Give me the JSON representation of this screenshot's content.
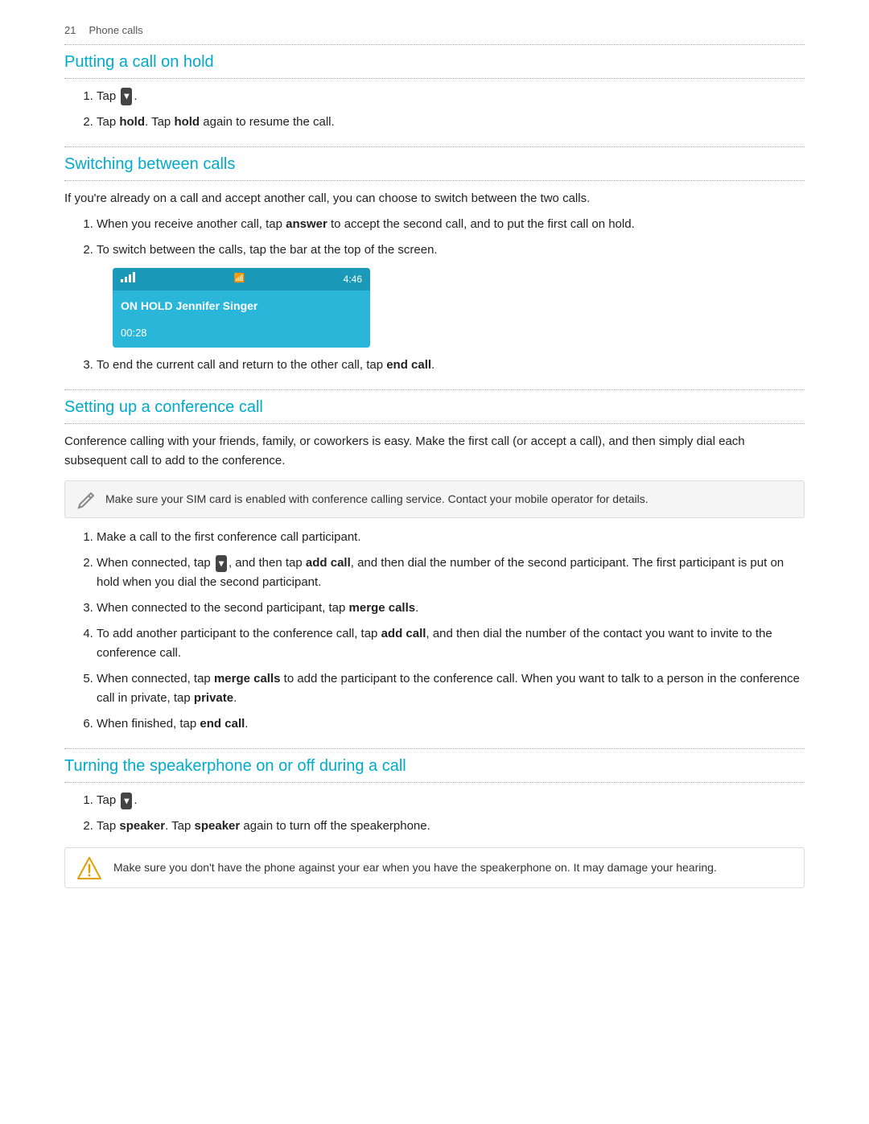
{
  "page": {
    "page_number": "21",
    "page_label": "Phone calls"
  },
  "sections": [
    {
      "id": "putting-call-on-hold",
      "title": "Putting a call on hold",
      "steps": [
        "Tap [icon].",
        "Tap hold. Tap hold again to resume the call."
      ]
    },
    {
      "id": "switching-between-calls",
      "title": "Switching between calls",
      "intro": "If you're already on a call and accept another call, you can choose to switch between the two calls.",
      "steps": [
        "When you receive another call, tap answer to accept the second call, and to put the first call on hold.",
        "To switch between the calls, tap the bar at the top of the screen.",
        "To end the current call and return to the other call, tap end call."
      ],
      "phone_screen": {
        "time": "4:46",
        "on_hold_label": "ON HOLD",
        "contact": "Jennifer Singer",
        "timer": "00:28"
      }
    },
    {
      "id": "setting-up-conference-call",
      "title": "Setting up a conference call",
      "intro": "Conference calling with your friends, family, or coworkers is easy. Make the first call (or accept a call), and then simply dial each subsequent call to add to the conference.",
      "note": "Make sure your SIM card is enabled with conference calling service. Contact your mobile operator for details.",
      "steps": [
        "Make a call to the first conference call participant.",
        "When connected, tap [icon], and then tap add call, and then dial the number of the second participant. The first participant is put on hold when you dial the second participant.",
        "When connected to the second participant, tap merge calls.",
        "To add another participant to the conference call, tap add call, and then dial the number of the contact you want to invite to the conference call.",
        "When connected, tap merge calls to add the participant to the conference call. When you want to talk to a person in the conference call in private, tap private.",
        "When finished, tap end call."
      ]
    },
    {
      "id": "turning-speakerphone",
      "title": "Turning the speakerphone on or off during a call",
      "steps": [
        "Tap [icon].",
        "Tap speaker. Tap speaker again to turn off the speakerphone."
      ],
      "warning": "Make sure you don't have the phone against your ear when you have the speakerphone on. It may damage your hearing."
    }
  ],
  "icons": {
    "tap_icon_label": "▾",
    "note_pencil": "✏",
    "warn_triangle": "⚠"
  }
}
